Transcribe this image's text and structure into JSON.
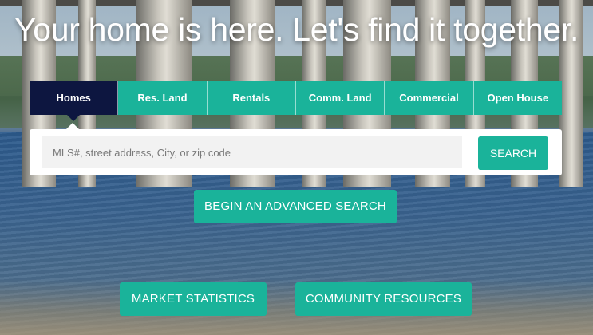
{
  "hero": {
    "headline": "Your home is here. Let's find it together."
  },
  "tabs": [
    {
      "label": "Homes",
      "active": true
    },
    {
      "label": "Res. Land",
      "active": false
    },
    {
      "label": "Rentals",
      "active": false
    },
    {
      "label": "Comm. Land",
      "active": false
    },
    {
      "label": "Commercial",
      "active": false
    },
    {
      "label": "Open House",
      "active": false
    }
  ],
  "search": {
    "placeholder": "MLS#, street address, City, or zip code",
    "button_label": "SEARCH"
  },
  "actions": {
    "advanced_search": "BEGIN AN ADVANCED SEARCH",
    "market_statistics": "MARKET STATISTICS",
    "community_resources": "COMMUNITY RESOURCES"
  },
  "colors": {
    "accent": "#1ab39a",
    "active_tab": "#0d1640",
    "panel": "#ffffff"
  }
}
